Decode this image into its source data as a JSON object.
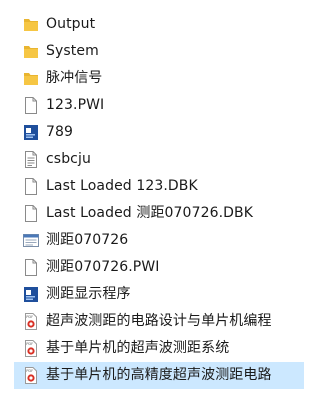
{
  "files": [
    {
      "name": "Output",
      "icon": "folder-icon"
    },
    {
      "name": "System",
      "icon": "folder-icon"
    },
    {
      "name": "脉冲信号",
      "icon": "folder-icon"
    },
    {
      "name": "123.PWI",
      "icon": "blank-file-icon"
    },
    {
      "name": "789",
      "icon": "executable-icon"
    },
    {
      "name": "csbcju",
      "icon": "text-file-icon"
    },
    {
      "name": "Last Loaded 123.DBK",
      "icon": "blank-file-icon"
    },
    {
      "name": "Last Loaded 测距070726.DBK",
      "icon": "blank-file-icon"
    },
    {
      "name": "测距070726",
      "icon": "project-file-icon"
    },
    {
      "name": "测距070726.PWI",
      "icon": "blank-file-icon"
    },
    {
      "name": "测距显示程序",
      "icon": "executable-icon"
    },
    {
      "name": "超声波测距的电路设计与单片机编程",
      "icon": "pdf-file-icon"
    },
    {
      "name": "基于单片机的超声波测距系统",
      "icon": "pdf-file-icon"
    },
    {
      "name": "基于单片机的高精度超声波测距电路",
      "icon": "pdf-file-icon"
    }
  ],
  "selected_index": 13,
  "colors": {
    "folder": "#f6c644",
    "selection": "#cce8ff",
    "exe": "#1f4f9c",
    "pdf_badge": "#d93025"
  }
}
